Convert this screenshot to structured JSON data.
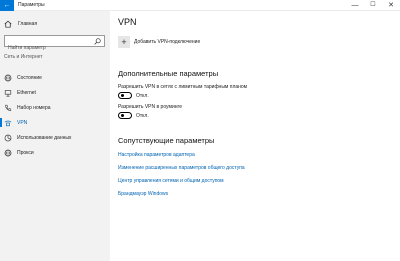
{
  "window": {
    "title": "Параметры",
    "back_glyph": "←",
    "minimize_glyph": "—",
    "maximize_glyph": "☐",
    "close_glyph": "✕"
  },
  "sidebar": {
    "home_label": "Главная",
    "search_placeholder": "Найти параметр",
    "section_label": "Сеть и Интернет",
    "items": [
      {
        "label": "Состояние",
        "icon": "globe-icon"
      },
      {
        "label": "Ethernet",
        "icon": "ethernet-icon"
      },
      {
        "label": "Набор номера",
        "icon": "phone-icon"
      },
      {
        "label": "VPN",
        "icon": "vpn-icon",
        "active": true
      },
      {
        "label": "Использование данных",
        "icon": "data-usage-icon"
      },
      {
        "label": "Прокси",
        "icon": "globe-icon"
      }
    ]
  },
  "main": {
    "vpn_heading": "VPN",
    "add_vpn_label": "Добавить VPN-подключение",
    "advanced_heading": "Дополнительные параметры",
    "metered_label": "Разрешить VPN в сетях с лимитным тарифным планом",
    "metered_state": "Откл.",
    "roaming_label": "Разрешить VPN в роуминге",
    "roaming_state": "Откл.",
    "related_heading": "Сопутствующие параметры",
    "links": [
      "Настройка параметров адаптера",
      "Изменение расширенных параметров общего доступа",
      "Центр управления сетями и общим доступом",
      "Брандмауэр Windows"
    ]
  },
  "colors": {
    "accent": "#0078d7",
    "link": "#0063b1",
    "sidebar_bg": "#f2f2f2"
  }
}
